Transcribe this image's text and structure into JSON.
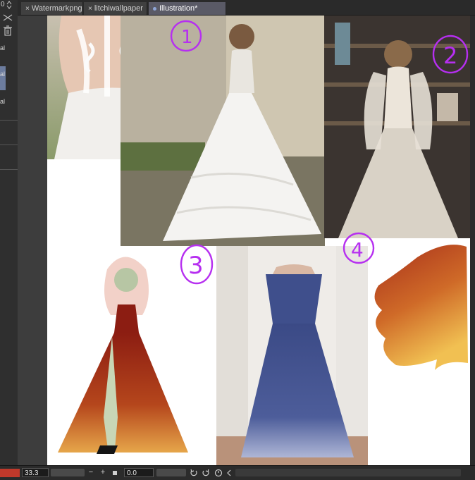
{
  "tabs": [
    {
      "label": "Watermarkpng",
      "close": "×",
      "active": false
    },
    {
      "label": "litchiwallpaper",
      "close": "×",
      "active": false
    },
    {
      "label": "Illustration*",
      "close": "",
      "active": true
    }
  ],
  "sidebar": {
    "top_value": "0",
    "labels": [
      "al",
      "al",
      "al"
    ]
  },
  "annotations": [
    "1",
    "2",
    "3",
    "4"
  ],
  "status": {
    "zoom": "33.3",
    "minus": "−",
    "plus": "+",
    "rotation": "0.0"
  }
}
